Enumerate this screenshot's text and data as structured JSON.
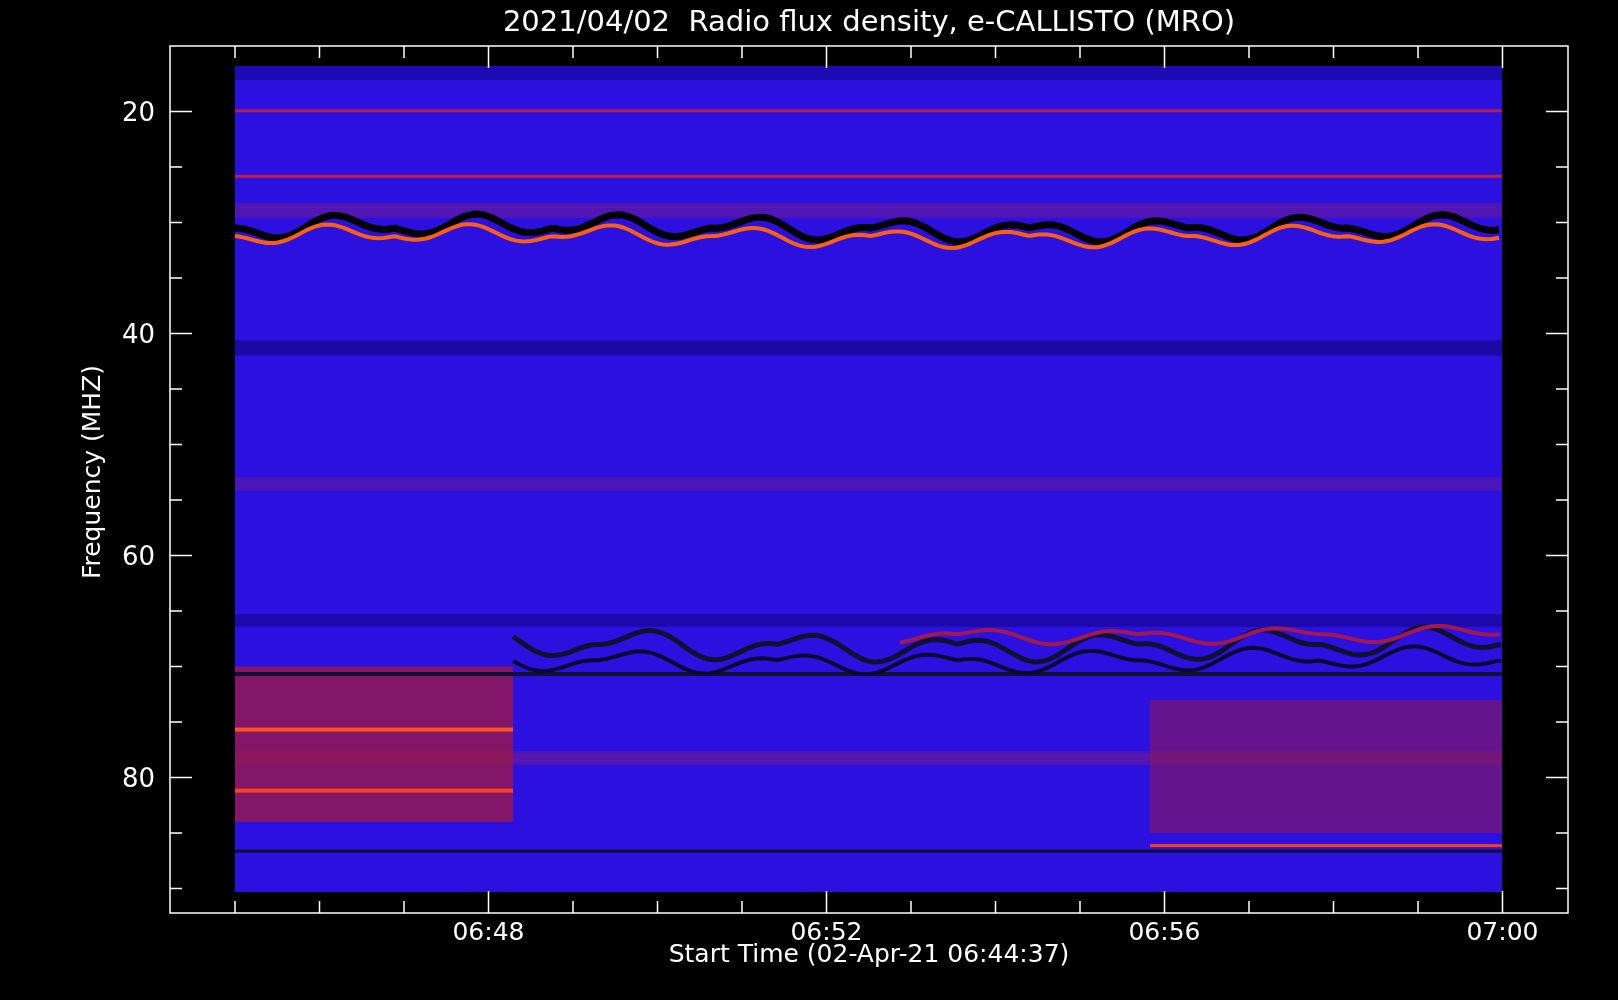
{
  "title": "2021/04/02  Radio flux density, e-CALLISTO (MRO)",
  "plot": {
    "ylabel": "Frequency (MHZ)",
    "xlabel": "Start Time (02-Apr-21 06:44:37)",
    "yticks": [
      "20",
      "40",
      "60",
      "80"
    ],
    "xticks": [
      "06:48",
      "06:52",
      "06:56",
      "07:00"
    ]
  }
}
